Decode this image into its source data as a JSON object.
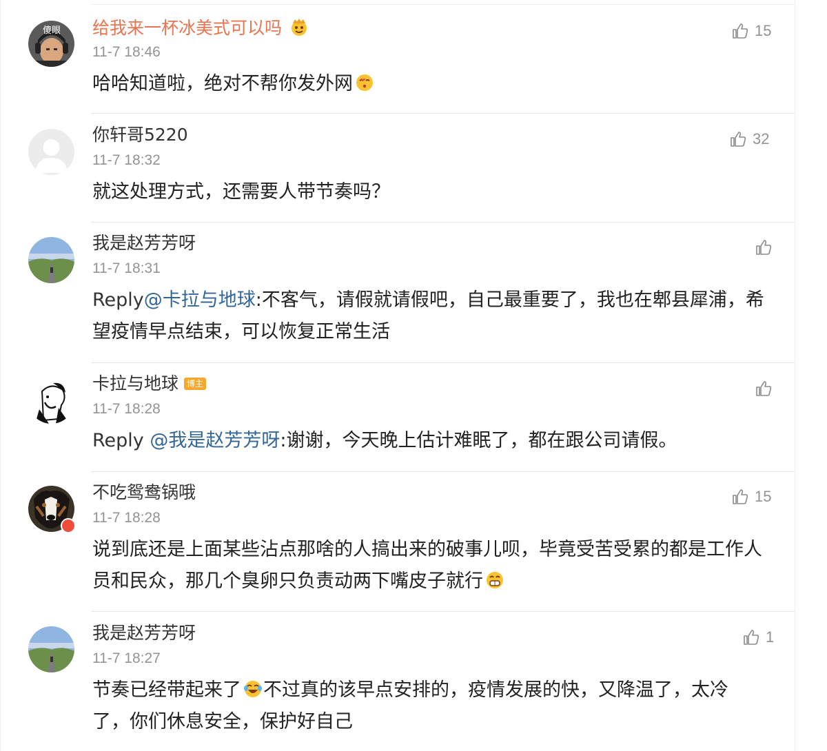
{
  "colors": {
    "accent_orange": "#eb7350",
    "link_blue": "#336699",
    "meta_gray": "#939393",
    "badge_orange": "#f7a72b"
  },
  "comments": [
    {
      "name": "给我来一杯冰美式可以吗",
      "name_emoji": "crown-face-emoji",
      "avatar_text": "傻眼",
      "time": "11-7 18:46",
      "likes": "15",
      "text": "哈哈知道啦，绝对不帮你发外网",
      "text_emoji": "kiss-face-emoji"
    },
    {
      "name": "你轩哥5220",
      "time": "11-7 18:32",
      "likes": "32",
      "text": "就这处理方式，还需要人带节奏吗？"
    },
    {
      "name": "我是赵芳芳呀",
      "time": "11-7 18:31",
      "likes": "",
      "reply_label": "Reply",
      "mention": "@卡拉与地球",
      "text": ":不客气，请假就请假吧，自己最重要了，我也在郫县犀浦，希望疫情早点结束，可以恢复正常生活"
    },
    {
      "name": "卡拉与地球",
      "badge": "博主",
      "time": "11-7 18:28",
      "likes": "",
      "reply_label": "Reply ",
      "mention": "@我是赵芳芳呀",
      "text": ":谢谢，今天晚上估计难眠了，都在跟公司请假。"
    },
    {
      "name": "不吃鸳鸯锅哦",
      "time": "11-7 18:28",
      "likes": "15",
      "text": "说到底还是上面某些沾点那啥的人搞出来的破事儿呗，毕竟受苦受累的都是工作人员和民众，那几个臭卵只负责动两下嘴皮子就行",
      "text_emoji": "grin-face-emoji"
    },
    {
      "name": "我是赵芳芳呀",
      "time": "11-7 18:27",
      "likes": "1",
      "text_a": "节奏已经带起来了",
      "text_emoji": "laugh-cry-emoji",
      "text_b": "不过真的该早点安排的，疫情发展的快，又降温了，太冷了，你们休息安全，保护好自己"
    }
  ]
}
